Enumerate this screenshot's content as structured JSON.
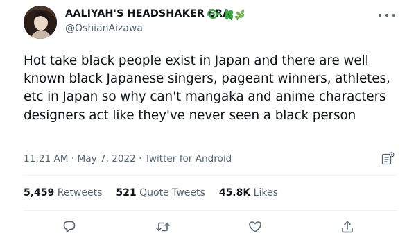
{
  "tweet": {
    "display_name": "AALIYAH'S HEADSHAKER ERA",
    "name_emoji_icons": [
      "tornado-swirl-icon",
      "four-leaf-clover-icon",
      "herb-icon"
    ],
    "handle": "@OshianAizawa",
    "text": "Hot take black people exist in Japan and there are well known black Japanese singers, pageant winners, athletes, etc  in Japan so why can't mangaka and anime characters designers act like they've never seen a black person",
    "time": "11:21 AM",
    "date": "May 7, 2022",
    "separator": "·",
    "source": "Twitter for Android"
  },
  "stats": {
    "retweets_count": "5,459",
    "retweets_label": "Retweets",
    "quotes_count": "521",
    "quotes_label": "Quote Tweets",
    "likes_count": "45.8K",
    "likes_label": "Likes"
  },
  "colors": {
    "text_primary": "#0f1419",
    "text_secondary": "#536471",
    "divider": "#eff3f4",
    "emoji_green": "#3aa845"
  }
}
